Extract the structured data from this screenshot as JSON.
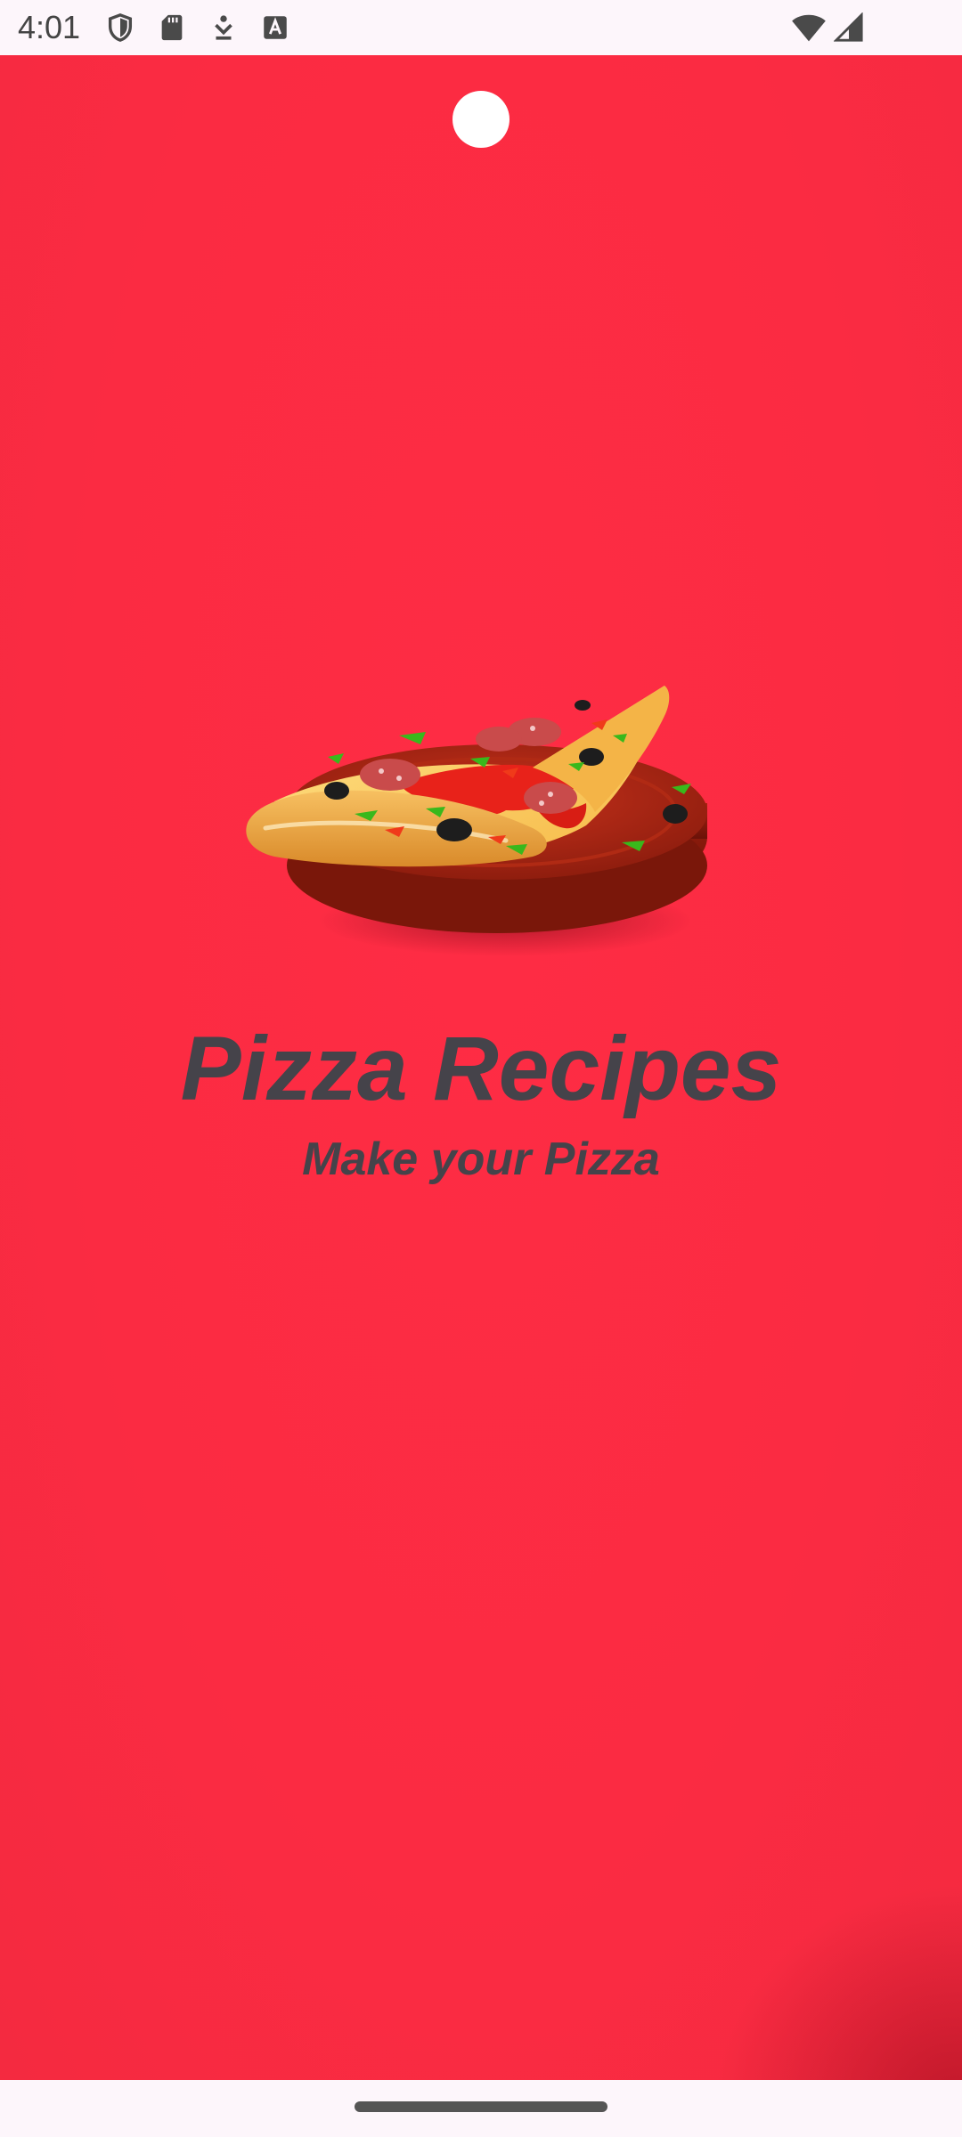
{
  "status_bar": {
    "time": "4:01",
    "icons": [
      "shield-icon",
      "sd-card-icon",
      "download-icon",
      "font-a-icon",
      "wifi-icon",
      "cellular-signal-icon"
    ]
  },
  "splash": {
    "background_color": "#fb2b42",
    "logo": "pizza-slice-icon",
    "title": "Pizza Recipes",
    "subtitle": "Make your Pizza",
    "text_color": "#45434a"
  },
  "navigation": {
    "home_indicator": "home-gesture-bar"
  }
}
